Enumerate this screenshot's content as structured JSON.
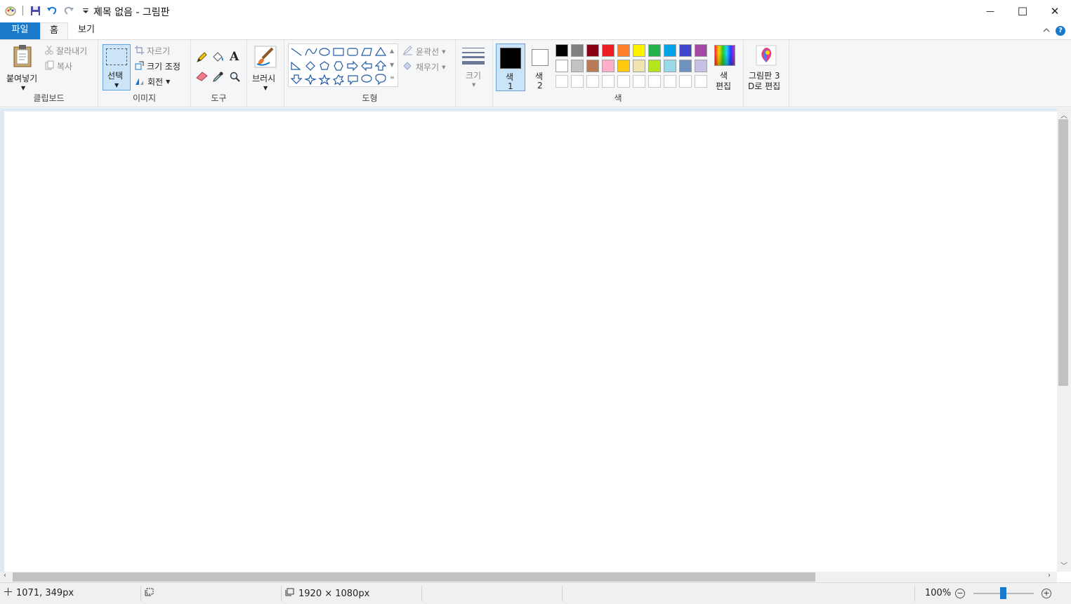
{
  "window": {
    "title": "제목 없음 - 그림판",
    "minimize_glyph": "—",
    "maximize_glyph": "☐",
    "close_glyph": "✕"
  },
  "tabs": {
    "file": "파일",
    "home": "홈",
    "view": "보기"
  },
  "clipboard": {
    "paste": "붙여넣기",
    "cut": "잘라내기",
    "copy": "복사",
    "group": "클립보드"
  },
  "image": {
    "select": "선택",
    "crop": "자르기",
    "resize": "크기 조정",
    "rotate": "회전",
    "group": "이미지"
  },
  "tools": {
    "group": "도구"
  },
  "brushes": {
    "label": "브러시"
  },
  "shapes": {
    "outline": "윤곽선",
    "fill": "채우기",
    "group": "도형"
  },
  "size": {
    "label": "크기"
  },
  "colors": {
    "color1": "색",
    "color1_num": "1",
    "color2": "색",
    "color2_num": "2",
    "edit_colors_1": "색",
    "edit_colors_2": "편집",
    "group": "색",
    "palette_row1": [
      "#000000",
      "#7f7f7f",
      "#880015",
      "#ed1c24",
      "#ff7f27",
      "#fff200",
      "#22b14c",
      "#00a2e8",
      "#3f48cc",
      "#a349a4"
    ],
    "palette_row2": [
      "#ffffff",
      "#c3c3c3",
      "#b97a57",
      "#ffaec9",
      "#ffc90e",
      "#efe4b0",
      "#b5e61d",
      "#99d9ea",
      "#7092be",
      "#c8bfe7"
    ],
    "palette_row3": [
      "#ffffff",
      "#ffffff",
      "#ffffff",
      "#ffffff",
      "#ffffff",
      "#ffffff",
      "#ffffff",
      "#ffffff",
      "#ffffff",
      "#ffffff"
    ]
  },
  "paint3d": {
    "line1": "그림판 3",
    "line2": "D로 편집"
  },
  "status": {
    "cursor_pos": "1071, 349px",
    "canvas_size": "1920 × 1080px",
    "zoom": "100%"
  }
}
